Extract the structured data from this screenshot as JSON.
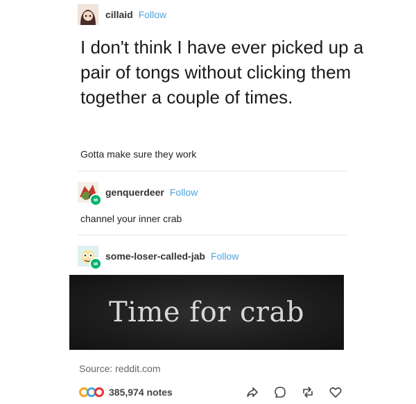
{
  "post": {
    "op": {
      "username": "cillaid",
      "follow_label": "Follow",
      "text": "I don't think I have ever picked up a pair of tongs without clicking them together a couple of times.",
      "tags": "Gotta make sure they work"
    },
    "reblog1": {
      "username": "genquerdeer",
      "follow_label": "Follow",
      "text": "channel your inner crab"
    },
    "reblog2": {
      "username": "some-loser-called-jab",
      "follow_label": "Follow",
      "image_caption": "Time for crab"
    },
    "source": "Source: reddit.com",
    "footer": {
      "notes": "385,974 notes",
      "note_colors": [
        "#f5a623",
        "#4aa3df",
        "#e9322d"
      ],
      "actions": [
        "share-icon",
        "reply-icon",
        "reblog-icon",
        "like-icon"
      ]
    },
    "colors": {
      "follow": "#4aa3df",
      "reblog_badge": "#00b36b",
      "image_bg": "#1c1c1c"
    }
  }
}
